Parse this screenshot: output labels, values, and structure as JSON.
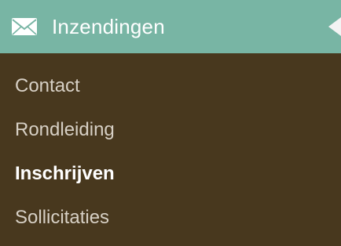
{
  "header": {
    "title": "Inzendingen",
    "icon": "envelope-icon"
  },
  "submenu": {
    "items": [
      {
        "label": "Contact",
        "active": false
      },
      {
        "label": "Rondleiding",
        "active": false
      },
      {
        "label": "Inschrijven",
        "active": true
      },
      {
        "label": "Sollicitaties",
        "active": false
      }
    ]
  },
  "colors": {
    "background": "#48381e",
    "header_background": "#78b5a4",
    "header_text": "#ffffff",
    "item_text": "#d7d0c5",
    "active_text": "#ffffff"
  }
}
